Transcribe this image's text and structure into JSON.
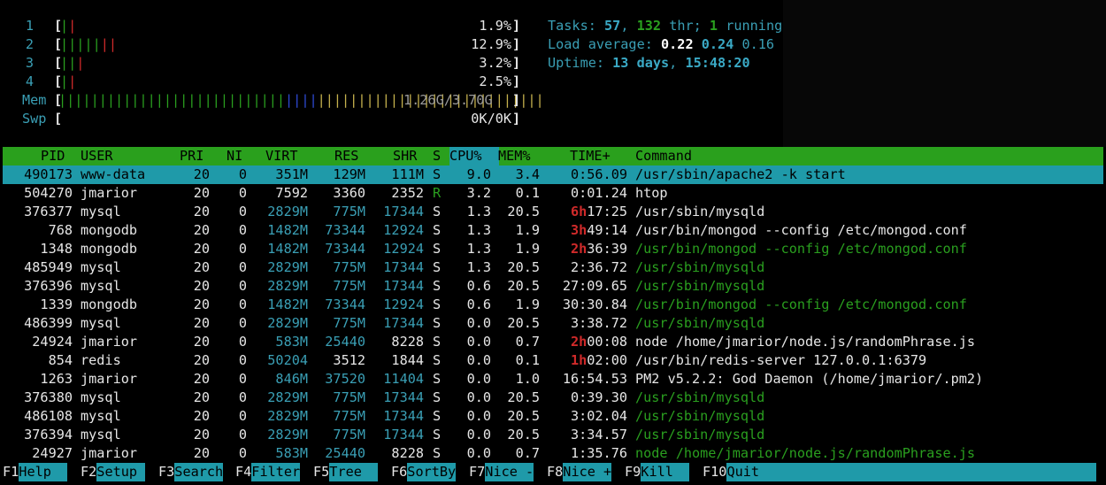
{
  "meters": {
    "cpus": [
      {
        "label": "1",
        "value": "1.9%",
        "bars": [
          {
            "c": "g",
            "n": 1
          },
          {
            "c": "r",
            "n": 1
          }
        ]
      },
      {
        "label": "2",
        "value": "12.9%",
        "bars": [
          {
            "c": "g",
            "n": 5
          },
          {
            "c": "r",
            "n": 2
          }
        ]
      },
      {
        "label": "3",
        "value": "3.2%",
        "bars": [
          {
            "c": "g",
            "n": 2
          },
          {
            "c": "r",
            "n": 1
          }
        ]
      },
      {
        "label": "4",
        "value": "2.5%",
        "bars": [
          {
            "c": "g",
            "n": 1
          },
          {
            "c": "r",
            "n": 1
          }
        ]
      }
    ],
    "mem": {
      "label": "Mem",
      "value_used": "1.26G",
      "value_sep": "/",
      "value_total": "3.70G"
    },
    "swp": {
      "label": "Swp",
      "value": "0K/0K"
    }
  },
  "stats": {
    "tasks_label": "Tasks: ",
    "tasks": "57",
    "sep1": ", ",
    "threads": "132",
    "thr_label": " thr; ",
    "running": "1",
    "running_label": " running",
    "load_label": "Load average: ",
    "load1": "0.22",
    "load5": "0.24",
    "load15": "0.16",
    "uptime_label": "Uptime: ",
    "uptime_days": "13 days",
    "uptime_sep": ", ",
    "uptime_time": "15:48:20"
  },
  "columns": [
    "PID",
    "USER",
    "PRI",
    "NI",
    "VIRT",
    "RES",
    "SHR",
    "S",
    "CPU%",
    "MEM%",
    "TIME+",
    "Command"
  ],
  "processes": [
    {
      "pid": "490173",
      "user": "www-data",
      "pri": "20",
      "ni": "0",
      "virt": "351M",
      "res": "129M",
      "shr": "111M",
      "s": "S",
      "cpu": "9.0",
      "mem": "3.4",
      "time_h": "",
      "time": "0:56.09",
      "cmd": "/usr/sbin/apache2 -k start",
      "thread": false,
      "selected": true
    },
    {
      "pid": "504270",
      "user": "jmarior",
      "pri": "20",
      "ni": "0",
      "virt": "7592",
      "res": "3360",
      "shr": "2352",
      "s": "R",
      "cpu": "3.2",
      "mem": "0.1",
      "time_h": "",
      "time": "0:01.24",
      "cmd": "htop",
      "thread": false,
      "selected": false
    },
    {
      "pid": "376377",
      "user": "mysql",
      "pri": "20",
      "ni": "0",
      "virt": "2829M",
      "res": "775M",
      "shr": "17344",
      "s": "S",
      "cpu": "1.3",
      "mem": "20.5",
      "time_h": "6h",
      "time": "17:25",
      "cmd": "/usr/sbin/mysqld",
      "thread": false,
      "selected": false
    },
    {
      "pid": "768",
      "user": "mongodb",
      "pri": "20",
      "ni": "0",
      "virt": "1482M",
      "res": "73344",
      "shr": "12924",
      "s": "S",
      "cpu": "1.3",
      "mem": "1.9",
      "time_h": "3h",
      "time": "49:14",
      "cmd": "/usr/bin/mongod --config /etc/mongod.conf",
      "thread": false,
      "selected": false
    },
    {
      "pid": "1348",
      "user": "mongodb",
      "pri": "20",
      "ni": "0",
      "virt": "1482M",
      "res": "73344",
      "shr": "12924",
      "s": "S",
      "cpu": "1.3",
      "mem": "1.9",
      "time_h": "2h",
      "time": "36:39",
      "cmd": "/usr/bin/mongod --config /etc/mongod.conf",
      "thread": true,
      "selected": false
    },
    {
      "pid": "485949",
      "user": "mysql",
      "pri": "20",
      "ni": "0",
      "virt": "2829M",
      "res": "775M",
      "shr": "17344",
      "s": "S",
      "cpu": "1.3",
      "mem": "20.5",
      "time_h": "",
      "time": "2:36.72",
      "cmd": "/usr/sbin/mysqld",
      "thread": true,
      "selected": false
    },
    {
      "pid": "376396",
      "user": "mysql",
      "pri": "20",
      "ni": "0",
      "virt": "2829M",
      "res": "775M",
      "shr": "17344",
      "s": "S",
      "cpu": "0.6",
      "mem": "20.5",
      "time_h": "",
      "time": "27:09.65",
      "cmd": "/usr/sbin/mysqld",
      "thread": true,
      "selected": false
    },
    {
      "pid": "1339",
      "user": "mongodb",
      "pri": "20",
      "ni": "0",
      "virt": "1482M",
      "res": "73344",
      "shr": "12924",
      "s": "S",
      "cpu": "0.6",
      "mem": "1.9",
      "time_h": "",
      "time": "30:30.84",
      "cmd": "/usr/bin/mongod --config /etc/mongod.conf",
      "thread": true,
      "selected": false
    },
    {
      "pid": "486399",
      "user": "mysql",
      "pri": "20",
      "ni": "0",
      "virt": "2829M",
      "res": "775M",
      "shr": "17344",
      "s": "S",
      "cpu": "0.0",
      "mem": "20.5",
      "time_h": "",
      "time": "3:38.72",
      "cmd": "/usr/sbin/mysqld",
      "thread": true,
      "selected": false
    },
    {
      "pid": "24924",
      "user": "jmarior",
      "pri": "20",
      "ni": "0",
      "virt": "583M",
      "res": "25440",
      "shr": "8228",
      "s": "S",
      "cpu": "0.0",
      "mem": "0.7",
      "time_h": "2h",
      "time": "00:08",
      "cmd": "node /home/jmarior/node.js/randomPhrase.js",
      "thread": false,
      "selected": false
    },
    {
      "pid": "854",
      "user": "redis",
      "pri": "20",
      "ni": "0",
      "virt": "50204",
      "res": "3512",
      "shr": "1844",
      "s": "S",
      "cpu": "0.0",
      "mem": "0.1",
      "time_h": "1h",
      "time": "02:00",
      "cmd": "/usr/bin/redis-server 127.0.0.1:6379",
      "thread": false,
      "selected": false
    },
    {
      "pid": "1263",
      "user": "jmarior",
      "pri": "20",
      "ni": "0",
      "virt": "846M",
      "res": "37520",
      "shr": "11404",
      "s": "S",
      "cpu": "0.0",
      "mem": "1.0",
      "time_h": "",
      "time": "16:54.53",
      "cmd": "PM2 v5.2.2: God Daemon (/home/jmarior/.pm2)",
      "thread": false,
      "selected": false
    },
    {
      "pid": "376380",
      "user": "mysql",
      "pri": "20",
      "ni": "0",
      "virt": "2829M",
      "res": "775M",
      "shr": "17344",
      "s": "S",
      "cpu": "0.0",
      "mem": "20.5",
      "time_h": "",
      "time": "0:39.30",
      "cmd": "/usr/sbin/mysqld",
      "thread": true,
      "selected": false
    },
    {
      "pid": "486108",
      "user": "mysql",
      "pri": "20",
      "ni": "0",
      "virt": "2829M",
      "res": "775M",
      "shr": "17344",
      "s": "S",
      "cpu": "0.0",
      "mem": "20.5",
      "time_h": "",
      "time": "3:02.04",
      "cmd": "/usr/sbin/mysqld",
      "thread": true,
      "selected": false
    },
    {
      "pid": "376394",
      "user": "mysql",
      "pri": "20",
      "ni": "0",
      "virt": "2829M",
      "res": "775M",
      "shr": "17344",
      "s": "S",
      "cpu": "0.0",
      "mem": "20.5",
      "time_h": "",
      "time": "3:34.57",
      "cmd": "/usr/sbin/mysqld",
      "thread": true,
      "selected": false
    },
    {
      "pid": "24927",
      "user": "jmarior",
      "pri": "20",
      "ni": "0",
      "virt": "583M",
      "res": "25440",
      "shr": "8228",
      "s": "S",
      "cpu": "0.0",
      "mem": "0.7",
      "time_h": "",
      "time": "1:35.76",
      "cmd": "node /home/jmarior/node.js/randomPhrase.js",
      "thread": true,
      "selected": false
    }
  ],
  "function_keys": [
    {
      "key": "F1",
      "label": "Help  "
    },
    {
      "key": "F2",
      "label": "Setup "
    },
    {
      "key": "F3",
      "label": "Search"
    },
    {
      "key": "F4",
      "label": "Filter"
    },
    {
      "key": "F5",
      "label": "Tree  "
    },
    {
      "key": "F6",
      "label": "SortBy"
    },
    {
      "key": "F7",
      "label": "Nice -"
    },
    {
      "key": "F8",
      "label": "Nice +"
    },
    {
      "key": "F9",
      "label": "Kill  "
    },
    {
      "key": "F10",
      "label": "Quit"
    }
  ],
  "colors": {
    "header_bg": "#2aa01d",
    "selected_bg": "#1f9aa9",
    "cyan": "#3a9fb5",
    "green": "#2a9f1f",
    "red": "#d02a2a"
  }
}
